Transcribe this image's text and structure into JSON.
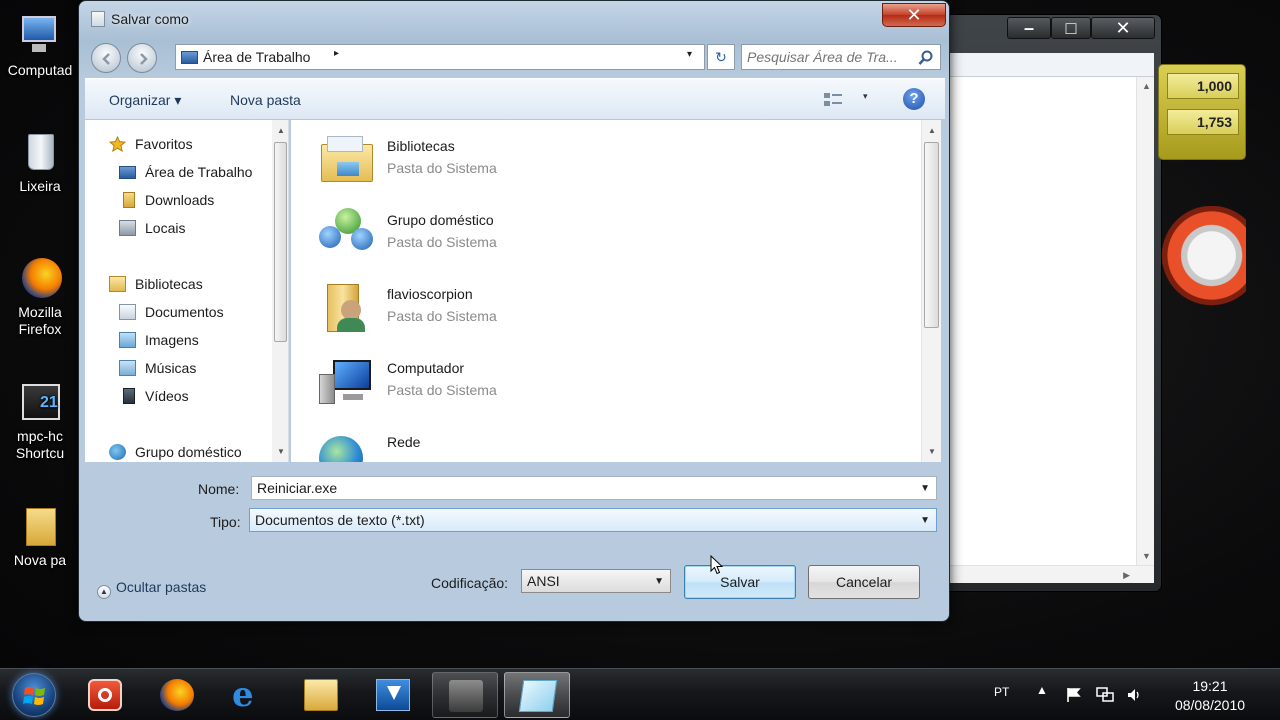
{
  "desktop": {
    "icons": [
      {
        "label": "Computad",
        "icon": "computer-icon"
      },
      {
        "label": "Lixeira",
        "icon": "recycle-bin-icon"
      },
      {
        "label": "Mozilla\nFirefox",
        "icon": "firefox-icon"
      },
      {
        "label": "mpc-hc\nShortcu",
        "icon": "media-player-icon"
      },
      {
        "label": "Nova pa",
        "icon": "folder-icon"
      }
    ]
  },
  "background_window": {
    "minimize": "–",
    "maximize": "□",
    "close": "✕"
  },
  "meter_gadget": {
    "values": [
      "1,000",
      "1,753"
    ]
  },
  "dialog": {
    "title": "Salvar como",
    "close_label": "✕",
    "address": {
      "location": "Área de Trabalho",
      "separator": "▸",
      "dropdown": "▾"
    },
    "refresh_glyph": "↻",
    "search": {
      "placeholder": "Pesquisar Área de Tra..."
    },
    "toolbar": {
      "organize": "Organizar ▾",
      "new_folder": "Nova pasta",
      "help": "?",
      "views_dropdown": "▾"
    },
    "nav": {
      "items": [
        {
          "label": "Favoritos",
          "group": true,
          "icon": "star-icon"
        },
        {
          "label": "Área de Trabalho",
          "group": false,
          "icon": "desktop-icon"
        },
        {
          "label": "Downloads",
          "group": false,
          "icon": "downloads-icon"
        },
        {
          "label": "Locais",
          "group": false,
          "icon": "places-icon"
        },
        {
          "label": "Bibliotecas",
          "group": true,
          "icon": "libraries-icon"
        },
        {
          "label": "Documentos",
          "group": false,
          "icon": "documents-icon"
        },
        {
          "label": "Imagens",
          "group": false,
          "icon": "pictures-icon"
        },
        {
          "label": "Músicas",
          "group": false,
          "icon": "music-icon"
        },
        {
          "label": "Vídeos",
          "group": false,
          "icon": "videos-icon"
        },
        {
          "label": "Grupo doméstico",
          "group": true,
          "icon": "homegroup-icon"
        }
      ]
    },
    "files": [
      {
        "name": "Bibliotecas",
        "type": "Pasta do Sistema",
        "icon": "libraries-folder-icon"
      },
      {
        "name": "Grupo doméstico",
        "type": "Pasta do Sistema",
        "icon": "homegroup-icon"
      },
      {
        "name": "flavioscorpion",
        "type": "Pasta do Sistema",
        "icon": "user-folder-icon"
      },
      {
        "name": "Computador",
        "type": "Pasta do Sistema",
        "icon": "computer-icon"
      },
      {
        "name": "Rede",
        "type": "",
        "icon": "network-icon"
      }
    ],
    "form": {
      "name_label": "Nome:",
      "name_value": "Reiniciar.exe",
      "type_label": "Tipo:",
      "type_value": "Documentos de texto (*.txt)",
      "encoding_label": "Codificação:",
      "encoding_value": "ANSI",
      "save_label": "Salvar",
      "cancel_label": "Cancelar",
      "hide_folders": "Ocultar pastas"
    }
  },
  "taskbar": {
    "apps": [
      {
        "name": "shutdown-app-icon",
        "state": "none"
      },
      {
        "name": "firefox-icon",
        "state": "none"
      },
      {
        "name": "internet-explorer-icon",
        "state": "none"
      },
      {
        "name": "explorer-folder-icon",
        "state": "none"
      },
      {
        "name": "download-app-icon",
        "state": "none"
      },
      {
        "name": "tool-app-icon",
        "state": "open"
      },
      {
        "name": "notepad-icon",
        "state": "active"
      }
    ],
    "language": "PT",
    "time": "19:21",
    "date": "08/08/2010"
  }
}
